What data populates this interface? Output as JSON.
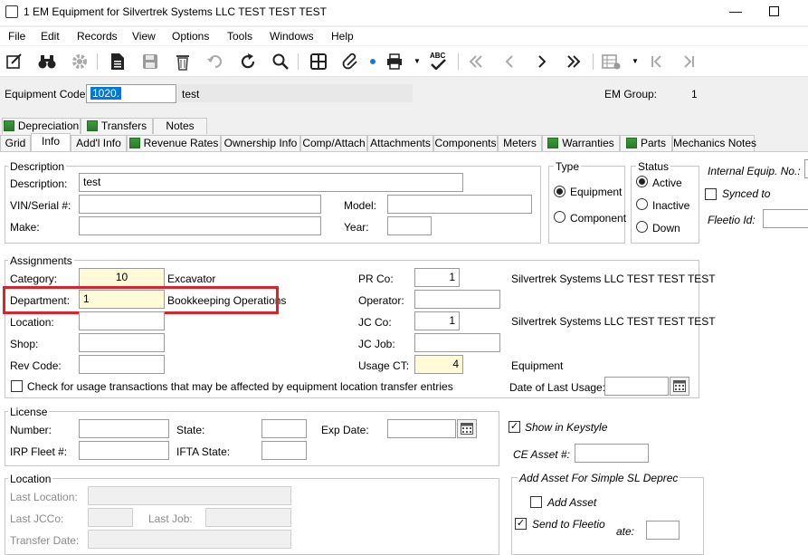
{
  "window": {
    "title": "1 EM Equipment for Silvertrek Systems LLC TEST TEST TEST",
    "minimize_glyph": "—",
    "maximize_glyph": "☐"
  },
  "menu": [
    "File",
    "Edit",
    "Records",
    "View",
    "Options",
    "Tools",
    "Windows",
    "Help"
  ],
  "toolbar": {
    "icons": [
      "edit-icon",
      "binoculars-icon",
      "gear-icon",
      "document-icon",
      "save-icon",
      "trash-icon",
      "undo-icon",
      "refresh-icon",
      "search-icon",
      "calculator-icon",
      "attach-icon",
      "print-icon",
      "spellcheck-icon",
      "first-record-icon",
      "previous-record-icon",
      "next-record-icon",
      "last-record-icon",
      "grid-settings-icon",
      "first-page-icon",
      "last-page-icon"
    ],
    "spellcheck_text": "ABC"
  },
  "header": {
    "equipment_code_label": "Equipment Code:",
    "equipment_code_value": "1020.",
    "equipment_desc": "test",
    "em_group_label": "EM Group:",
    "em_group_value": "1"
  },
  "tabs_row1": [
    "Depreciation",
    "Transfers",
    "Notes"
  ],
  "tabs_row2": [
    "Grid",
    "Info",
    "Add'l Info",
    "Revenue Rates",
    "Ownership Info",
    "Comp/Attach",
    "Attachments",
    "Components",
    "Meters",
    "Warranties",
    "Parts",
    "Mechanics Notes"
  ],
  "active_tab": "Info",
  "description": {
    "title": "Description",
    "description_label": "Description:",
    "description_value": "test",
    "vin_label": "VIN/Serial #:",
    "vin_value": "",
    "model_label": "Model:",
    "model_value": "",
    "make_label": "Make:",
    "make_value": "",
    "year_label": "Year:",
    "year_value": ""
  },
  "type": {
    "title": "Type",
    "options": [
      "Equipment",
      "Component"
    ],
    "selected": "Equipment"
  },
  "status": {
    "title": "Status",
    "options": [
      "Active",
      "Inactive",
      "Down"
    ],
    "selected": "Active"
  },
  "right_panel": {
    "internal_equip_label": "Internal Equip. No.:",
    "synced_to_label": "Synced to",
    "fleetio_id_label": "Fleetio Id:",
    "show_in_keystyle_label": "Show in Keystyle",
    "ce_asset_label": "CE Asset #:",
    "add_asset_group_title": "Add Asset For Simple SL Deprec",
    "add_asset_label": "Add Asset",
    "send_to_fleetio_label": "Send to Fleetio",
    "date_partial_label": "ate:"
  },
  "assignments": {
    "title": "Assignments",
    "category_label": "Category:",
    "category_value": "10",
    "category_desc": "Excavator",
    "department_label": "Department:",
    "department_value": "1",
    "department_desc": "Bookkeeping Operations",
    "location_label": "Location:",
    "shop_label": "Shop:",
    "rev_code_label": "Rev Code:",
    "pr_co_label": "PR Co:",
    "pr_co_value": "1",
    "pr_co_desc": "Silvertrek Systems LLC TEST TEST TEST",
    "operator_label": "Operator:",
    "jc_co_label": "JC Co:",
    "jc_co_value": "1",
    "jc_co_desc": "Silvertrek Systems LLC TEST TEST TEST",
    "jc_job_label": "JC Job:",
    "usage_ct_label": "Usage CT:",
    "usage_ct_value": "4",
    "usage_ct_desc": "Equipment",
    "date_last_usage_label": "Date of Last Usage:",
    "check_usage_label": "Check for usage transactions that may be affected by equipment location transfer entries"
  },
  "license": {
    "title": "License",
    "number_label": "Number:",
    "state_label": "State:",
    "exp_date_label": "Exp Date:",
    "irp_fleet_label": "IRP Fleet #:",
    "ifta_state_label": "IFTA State:"
  },
  "location": {
    "title": "Location",
    "last_location_label": "Last Location:",
    "last_jcco_label": "Last JCCo:",
    "last_job_label": "Last Job:",
    "transfer_date_label": "Transfer Date:"
  },
  "colors": {
    "highlight": "#d9242b",
    "required_field": "#fffbd8",
    "selection": "#0078d7"
  }
}
